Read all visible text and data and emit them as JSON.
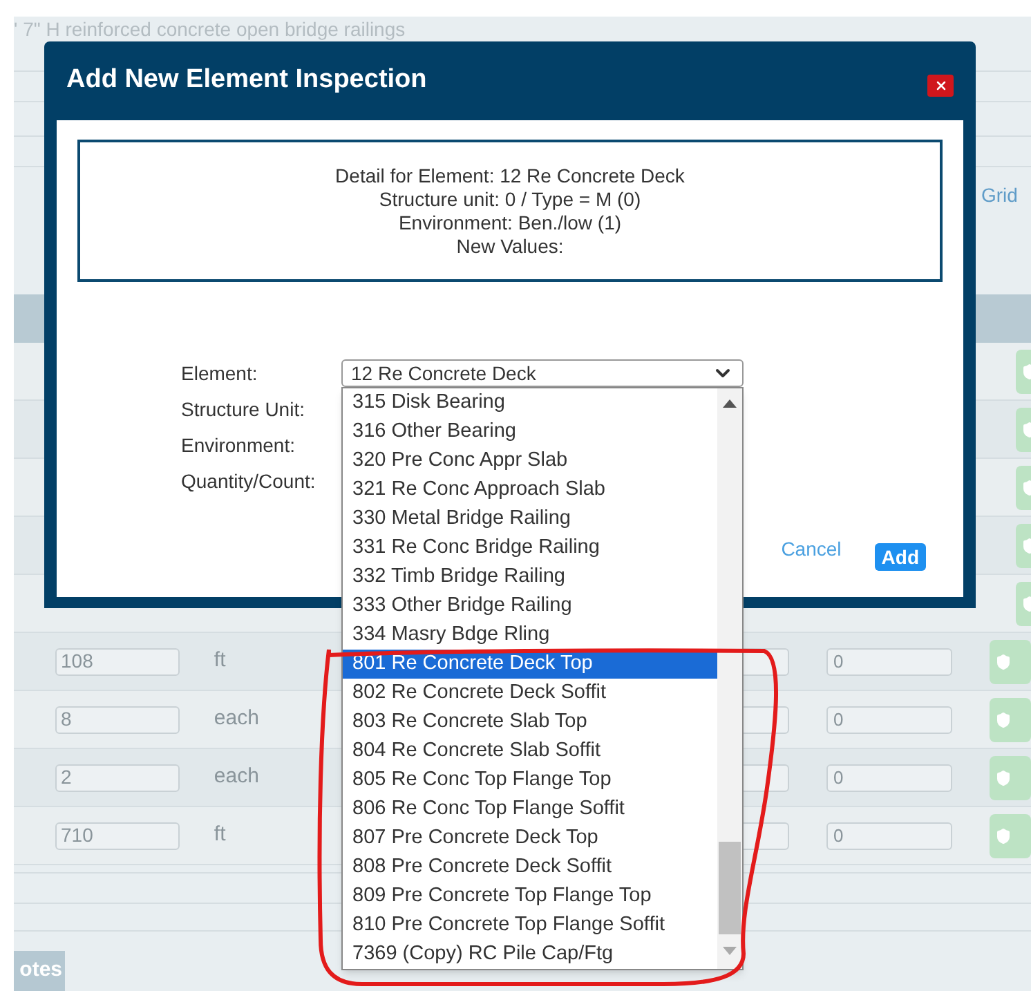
{
  "background": {
    "caption": "' 7\" H reinforced concrete open bridge railings",
    "link": "Grid",
    "rows": [
      {
        "kind": "covered"
      },
      {
        "kind": "covered"
      },
      {
        "kind": "covered"
      },
      {
        "kind": "covered"
      },
      {
        "kind": "covered"
      },
      {
        "kind": "full",
        "quantity": "108",
        "unit": "ft",
        "column_3": "0"
      },
      {
        "kind": "full",
        "quantity": "8",
        "unit": "each",
        "column_3": "0"
      },
      {
        "kind": "full",
        "quantity": "2",
        "unit": "each",
        "column_3": "0"
      },
      {
        "kind": "full",
        "quantity": "710",
        "unit": "ft",
        "column_3": "0"
      }
    ],
    "tab": "otes"
  },
  "dialog": {
    "title": "Add New Element Inspection",
    "detail_lines": [
      "Detail for Element: 12 Re Concrete Deck",
      "Structure unit: 0 / Type = M (0)",
      "Environment: Ben./low (1)",
      "New Values:"
    ],
    "fields": [
      {
        "label": "Element:"
      },
      {
        "label": "Structure Unit:"
      },
      {
        "label": "Environment:"
      },
      {
        "label": "Quantity/Count:"
      }
    ],
    "element_select": {
      "value": "12 Re Concrete Deck"
    },
    "cancel": "Cancel",
    "add": "Add"
  },
  "dropdown": {
    "options": [
      {
        "label": "315 Disk Bearing",
        "selected": false
      },
      {
        "label": "316 Other Bearing",
        "selected": false
      },
      {
        "label": "320 Pre Conc Appr Slab",
        "selected": false
      },
      {
        "label": "321 Re Conc Approach Slab",
        "selected": false
      },
      {
        "label": "330 Metal Bridge Railing",
        "selected": false
      },
      {
        "label": "331 Re Conc Bridge Railing",
        "selected": false
      },
      {
        "label": "332 Timb Bridge Railing",
        "selected": false
      },
      {
        "label": "333 Other Bridge Railing",
        "selected": false
      },
      {
        "label": "334 Masry Bdge Rling",
        "selected": false
      },
      {
        "label": "801 Re Concrete Deck Top",
        "selected": true
      },
      {
        "label": "802 Re Concrete Deck Soffit",
        "selected": false
      },
      {
        "label": "803 Re Concrete Slab Top",
        "selected": false
      },
      {
        "label": "804 Re Concrete Slab Soffit",
        "selected": false
      },
      {
        "label": "805 Re Conc Top Flange Top",
        "selected": false
      },
      {
        "label": "806 Re Conc Top Flange Soffit",
        "selected": false
      },
      {
        "label": "807 Pre Concrete Deck Top",
        "selected": false
      },
      {
        "label": "808 Pre Concrete Deck Soffit",
        "selected": false
      },
      {
        "label": "809 Pre Concrete Top Flange Top",
        "selected": false
      },
      {
        "label": "810 Pre Concrete Top Flange Soffit",
        "selected": false
      },
      {
        "label": "7369 (Copy) RC Pile Cap/Ftg",
        "selected": false
      }
    ]
  }
}
